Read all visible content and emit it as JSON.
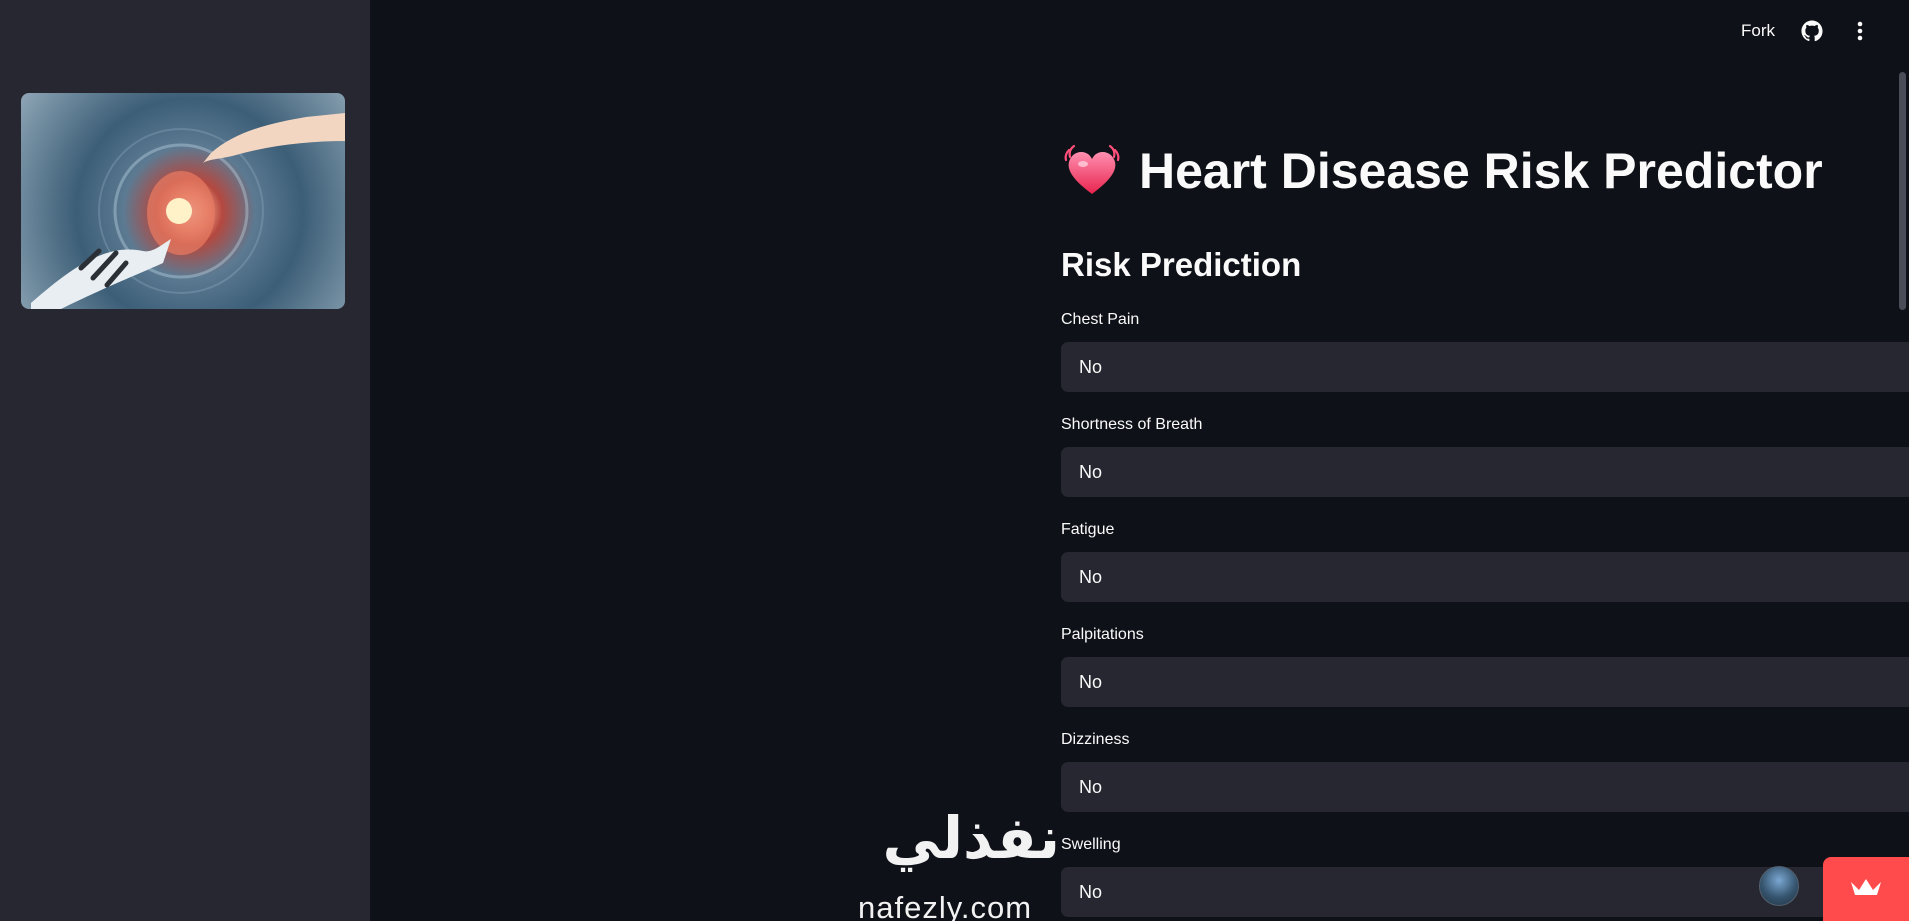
{
  "header": {
    "fork_label": "Fork",
    "icons": [
      "github-icon",
      "more-vertical-icon"
    ]
  },
  "sidebar": {
    "image": "robot-and-human-hands-heart-hologram"
  },
  "main": {
    "title_emoji": "beating-heart-icon",
    "title": "Heart Disease Risk Predictor",
    "section_title": "Risk Prediction",
    "fields": [
      {
        "label": "Chest Pain",
        "value": "No"
      },
      {
        "label": "Shortness of Breath",
        "value": "No"
      },
      {
        "label": "Fatigue",
        "value": "No"
      },
      {
        "label": "Palpitations",
        "value": "No"
      },
      {
        "label": "Dizziness",
        "value": "No"
      },
      {
        "label": "Swelling",
        "value": "No"
      }
    ]
  },
  "watermark": {
    "arabic": "نفذلي",
    "latin": "nafezly.com"
  },
  "colors": {
    "background": "#0e1117",
    "sidebar": "#262730",
    "select": "#262730",
    "accent": "#ff4b4b"
  }
}
